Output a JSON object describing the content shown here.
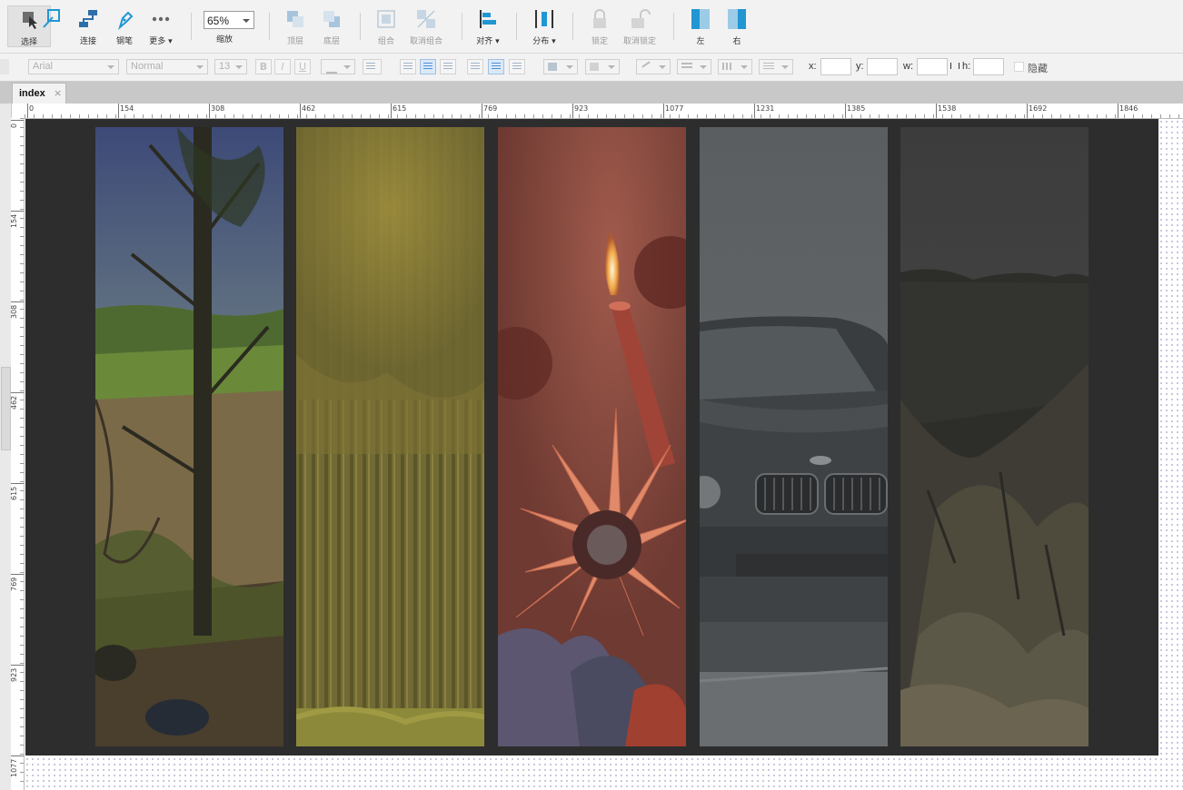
{
  "toolbar": {
    "select": "选择",
    "connect": "连接",
    "pen": "钢笔",
    "more": "更多 ▾",
    "zoom_value": "65%",
    "zoom_label": "缩放",
    "top_layer": "顶层",
    "bottom_layer": "底层",
    "group": "组合",
    "ungroup": "取消组合",
    "align": "对齐 ▾",
    "distribute": "分布 ▾",
    "lock": "锁定",
    "unlock": "取消锁定",
    "left": "左",
    "right": "右",
    "accent_color": "#2196d3"
  },
  "formatbar": {
    "font_family": "Arial",
    "font_style": "Normal",
    "font_size": "13",
    "bold": "B",
    "italic": "I",
    "underline": "U",
    "x_label": "x:",
    "y_label": "y:",
    "w_label": "w:",
    "h_label": "h:",
    "hidden_label": "隐藏"
  },
  "tabs": [
    {
      "label": "index",
      "close": "×"
    }
  ],
  "ruler": {
    "top_ticks": [
      "0",
      "154",
      "308",
      "462",
      "615",
      "769",
      "923",
      "1077",
      "1231",
      "1385",
      "1538",
      "1692",
      "1846"
    ],
    "left_ticks": [
      "0",
      "154",
      "308",
      "462",
      "615",
      "769",
      "923",
      "1077"
    ]
  },
  "canvas": {
    "board_color": "#2d2d2d",
    "panels": [
      {
        "subject": "tree-landscape",
        "tint": "#6b6a3c"
      },
      {
        "subject": "yellow-green-forest",
        "tint": "#7a7133"
      },
      {
        "subject": "candle-and-sunflower",
        "tint": "#8a4a3e"
      },
      {
        "subject": "grey-car-front",
        "tint": "#5c5f60"
      },
      {
        "subject": "dark-cliffs",
        "tint": "#3e3e3a"
      }
    ]
  }
}
